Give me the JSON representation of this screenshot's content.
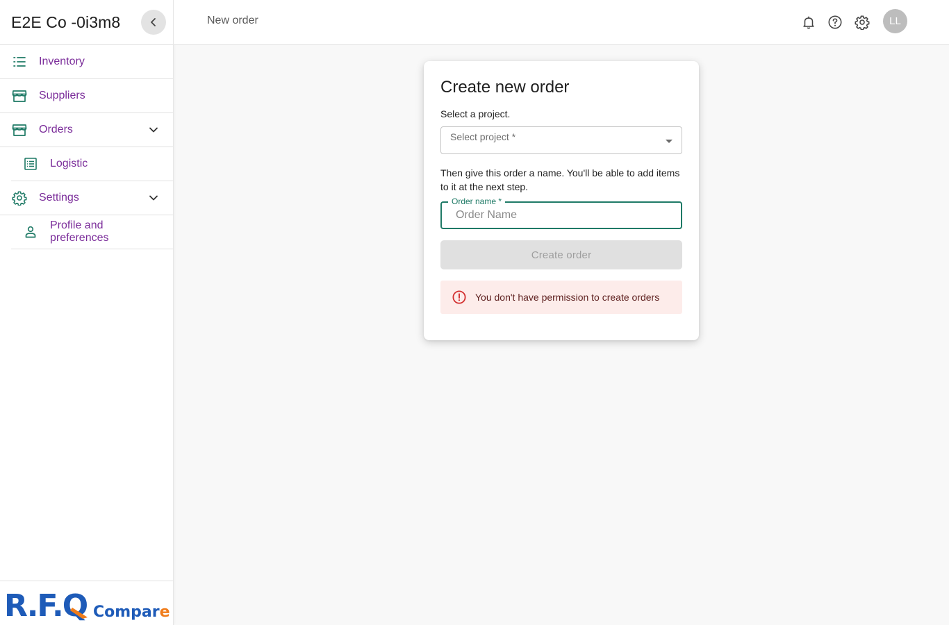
{
  "sidebar": {
    "brand": "E2E Co -0i3m8",
    "items": [
      {
        "label": "Inventory"
      },
      {
        "label": "Suppliers"
      },
      {
        "label": "Orders"
      },
      {
        "label": "Logistic"
      },
      {
        "label": "Settings"
      },
      {
        "label": "Profile and preferences"
      }
    ],
    "logo": {
      "main": "R.F.Q",
      "sub": "Compare"
    }
  },
  "header": {
    "title": "New order",
    "avatar_initials": "LL"
  },
  "card": {
    "title": "Create new order",
    "select_prompt": "Select a project.",
    "select_placeholder": "Select project *",
    "name_prompt": "Then give this order a name. You'll be able to add items to it at the next step.",
    "name_label": "Order name *",
    "name_placeholder": "Order Name",
    "name_value": "",
    "submit_label": "Create order",
    "error_message": "You don't have permission to create orders"
  },
  "colors": {
    "accent_teal": "#1f7a66",
    "nav_purple": "#7b2d9a",
    "logo_blue": "#1e5bb8",
    "logo_orange": "#f07c1a",
    "error_red": "#d32f2f"
  }
}
